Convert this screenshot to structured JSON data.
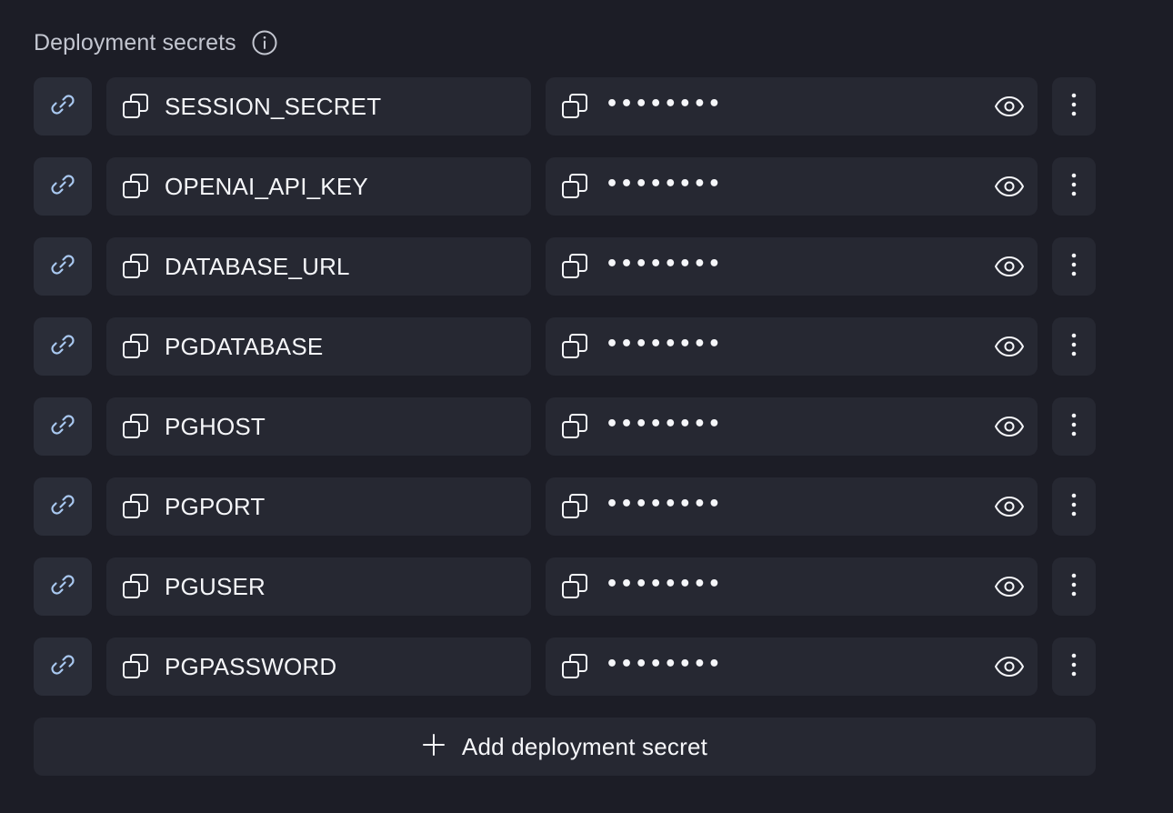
{
  "section": {
    "title": "Deployment secrets",
    "info_icon": "info-icon"
  },
  "secrets": [
    {
      "key": "SESSION_SECRET",
      "value": "••••••••"
    },
    {
      "key": "OPENAI_API_KEY",
      "value": "••••••••"
    },
    {
      "key": "DATABASE_URL",
      "value": "••••••••"
    },
    {
      "key": "PGDATABASE",
      "value": "••••••••"
    },
    {
      "key": "PGHOST",
      "value": "••••••••"
    },
    {
      "key": "PGPORT",
      "value": "••••••••"
    },
    {
      "key": "PGUSER",
      "value": "••••••••"
    },
    {
      "key": "PGPASSWORD",
      "value": "••••••••"
    }
  ],
  "add_button": {
    "label": "Add deployment secret",
    "icon": "plus-icon"
  },
  "icons": {
    "row_link": "link-icon",
    "copy": "copy-icon",
    "reveal": "eye-icon",
    "menu": "more-vertical-icon"
  },
  "colors": {
    "background": "#1c1d26",
    "field": "#262832",
    "link_icon": "#a9c8f0",
    "text": "#f5f6f9",
    "muted": "#c3c6d0"
  }
}
